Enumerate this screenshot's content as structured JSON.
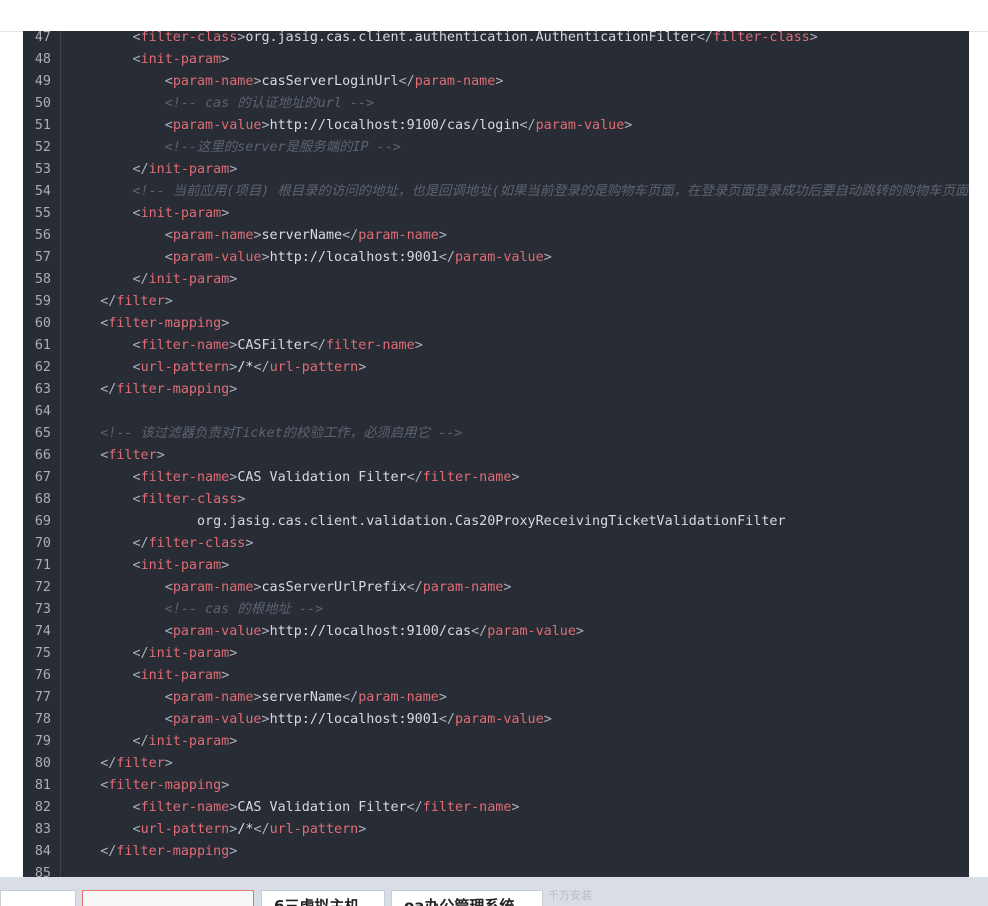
{
  "editor": {
    "lines": [
      {
        "n": "47",
        "t": [
          [
            "",
            "        "
          ],
          [
            "br",
            "<"
          ],
          [
            "tg",
            "filter-class"
          ],
          [
            "br",
            ">"
          ],
          [
            "tx",
            "org.jasig.cas.client.authentication.AuthenticationFilter"
          ],
          [
            "br",
            "</"
          ],
          [
            "tg",
            "filter-class"
          ],
          [
            "br",
            ">"
          ]
        ]
      },
      {
        "n": "48",
        "t": [
          [
            "",
            "        "
          ],
          [
            "br",
            "<"
          ],
          [
            "tg",
            "init-param"
          ],
          [
            "br",
            ">"
          ]
        ]
      },
      {
        "n": "49",
        "t": [
          [
            "",
            "            "
          ],
          [
            "br",
            "<"
          ],
          [
            "tg",
            "param-name"
          ],
          [
            "br",
            ">"
          ],
          [
            "tx",
            "casServerLoginUrl"
          ],
          [
            "br",
            "</"
          ],
          [
            "tg",
            "param-name"
          ],
          [
            "br",
            ">"
          ]
        ]
      },
      {
        "n": "50",
        "t": [
          [
            "",
            "            "
          ],
          [
            "cm",
            "<!-- cas 的认证地址的url -->"
          ]
        ]
      },
      {
        "n": "51",
        "t": [
          [
            "",
            "            "
          ],
          [
            "br",
            "<"
          ],
          [
            "tg",
            "param-value"
          ],
          [
            "br",
            ">"
          ],
          [
            "tx",
            "http://localhost:9100/cas/login"
          ],
          [
            "br",
            "</"
          ],
          [
            "tg",
            "param-value"
          ],
          [
            "br",
            ">"
          ]
        ]
      },
      {
        "n": "52",
        "t": [
          [
            "",
            "            "
          ],
          [
            "cm",
            "<!--这里的server是服务端的IP -->"
          ]
        ]
      },
      {
        "n": "53",
        "t": [
          [
            "",
            "        "
          ],
          [
            "br",
            "</"
          ],
          [
            "tg",
            "init-param"
          ],
          [
            "br",
            ">"
          ]
        ]
      },
      {
        "n": "54",
        "t": [
          [
            "",
            "        "
          ],
          [
            "cm",
            "<!-- 当前应用(项目) 根目录的访问的地址，也是回调地址(如果当前登录的是购物车页面，在登录页面登录成功后要自动跳转的购物车页面"
          ]
        ]
      },
      {
        "n": "55",
        "t": [
          [
            "",
            "        "
          ],
          [
            "br",
            "<"
          ],
          [
            "tg",
            "init-param"
          ],
          [
            "br",
            ">"
          ]
        ]
      },
      {
        "n": "56",
        "t": [
          [
            "",
            "            "
          ],
          [
            "br",
            "<"
          ],
          [
            "tg",
            "param-name"
          ],
          [
            "br",
            ">"
          ],
          [
            "tx",
            "serverName"
          ],
          [
            "br",
            "</"
          ],
          [
            "tg",
            "param-name"
          ],
          [
            "br",
            ">"
          ]
        ]
      },
      {
        "n": "57",
        "t": [
          [
            "",
            "            "
          ],
          [
            "br",
            "<"
          ],
          [
            "tg",
            "param-value"
          ],
          [
            "br",
            ">"
          ],
          [
            "tx",
            "http://localhost:9001"
          ],
          [
            "br",
            "</"
          ],
          [
            "tg",
            "param-value"
          ],
          [
            "br",
            ">"
          ]
        ]
      },
      {
        "n": "58",
        "t": [
          [
            "",
            "        "
          ],
          [
            "br",
            "</"
          ],
          [
            "tg",
            "init-param"
          ],
          [
            "br",
            ">"
          ]
        ]
      },
      {
        "n": "59",
        "t": [
          [
            "",
            "    "
          ],
          [
            "br",
            "</"
          ],
          [
            "tg",
            "filter"
          ],
          [
            "br",
            ">"
          ]
        ]
      },
      {
        "n": "60",
        "t": [
          [
            "",
            "    "
          ],
          [
            "br",
            "<"
          ],
          [
            "tg",
            "filter-mapping"
          ],
          [
            "br",
            ">"
          ]
        ]
      },
      {
        "n": "61",
        "t": [
          [
            "",
            "        "
          ],
          [
            "br",
            "<"
          ],
          [
            "tg",
            "filter-name"
          ],
          [
            "br",
            ">"
          ],
          [
            "tx",
            "CASFilter"
          ],
          [
            "br",
            "</"
          ],
          [
            "tg",
            "filter-name"
          ],
          [
            "br",
            ">"
          ]
        ]
      },
      {
        "n": "62",
        "t": [
          [
            "",
            "        "
          ],
          [
            "br",
            "<"
          ],
          [
            "tg",
            "url-pattern"
          ],
          [
            "br",
            ">"
          ],
          [
            "tx",
            "/*"
          ],
          [
            "br",
            "</"
          ],
          [
            "tg",
            "url-pattern"
          ],
          [
            "br",
            ">"
          ]
        ]
      },
      {
        "n": "63",
        "t": [
          [
            "",
            "    "
          ],
          [
            "br",
            "</"
          ],
          [
            "tg",
            "filter-mapping"
          ],
          [
            "br",
            ">"
          ]
        ]
      },
      {
        "n": "64",
        "t": []
      },
      {
        "n": "65",
        "t": [
          [
            "",
            "    "
          ],
          [
            "cm",
            "<!-- 该过滤器负责对Ticket的校验工作，必须启用它 -->"
          ]
        ]
      },
      {
        "n": "66",
        "t": [
          [
            "",
            "    "
          ],
          [
            "br",
            "<"
          ],
          [
            "tg",
            "filter"
          ],
          [
            "br",
            ">"
          ]
        ]
      },
      {
        "n": "67",
        "t": [
          [
            "",
            "        "
          ],
          [
            "br",
            "<"
          ],
          [
            "tg",
            "filter-name"
          ],
          [
            "br",
            ">"
          ],
          [
            "tx",
            "CAS Validation Filter"
          ],
          [
            "br",
            "</"
          ],
          [
            "tg",
            "filter-name"
          ],
          [
            "br",
            ">"
          ]
        ]
      },
      {
        "n": "68",
        "t": [
          [
            "",
            "        "
          ],
          [
            "br",
            "<"
          ],
          [
            "tg",
            "filter-class"
          ],
          [
            "br",
            ">"
          ]
        ]
      },
      {
        "n": "69",
        "t": [
          [
            "",
            "                "
          ],
          [
            "tx",
            "org.jasig.cas.client.validation.Cas20ProxyReceivingTicketValidationFilter"
          ]
        ]
      },
      {
        "n": "70",
        "t": [
          [
            "",
            "        "
          ],
          [
            "br",
            "</"
          ],
          [
            "tg",
            "filter-class"
          ],
          [
            "br",
            ">"
          ]
        ]
      },
      {
        "n": "71",
        "t": [
          [
            "",
            "        "
          ],
          [
            "br",
            "<"
          ],
          [
            "tg",
            "init-param"
          ],
          [
            "br",
            ">"
          ]
        ]
      },
      {
        "n": "72",
        "t": [
          [
            "",
            "            "
          ],
          [
            "br",
            "<"
          ],
          [
            "tg",
            "param-name"
          ],
          [
            "br",
            ">"
          ],
          [
            "tx",
            "casServerUrlPrefix"
          ],
          [
            "br",
            "</"
          ],
          [
            "tg",
            "param-name"
          ],
          [
            "br",
            ">"
          ]
        ]
      },
      {
        "n": "73",
        "t": [
          [
            "",
            "            "
          ],
          [
            "cm",
            "<!-- cas 的根地址 -->"
          ]
        ]
      },
      {
        "n": "74",
        "t": [
          [
            "",
            "            "
          ],
          [
            "br",
            "<"
          ],
          [
            "tg",
            "param-value"
          ],
          [
            "br",
            ">"
          ],
          [
            "tx",
            "http://localhost:9100/cas"
          ],
          [
            "br",
            "</"
          ],
          [
            "tg",
            "param-value"
          ],
          [
            "br",
            ">"
          ]
        ]
      },
      {
        "n": "75",
        "t": [
          [
            "",
            "        "
          ],
          [
            "br",
            "</"
          ],
          [
            "tg",
            "init-param"
          ],
          [
            "br",
            ">"
          ]
        ]
      },
      {
        "n": "76",
        "t": [
          [
            "",
            "        "
          ],
          [
            "br",
            "<"
          ],
          [
            "tg",
            "init-param"
          ],
          [
            "br",
            ">"
          ]
        ]
      },
      {
        "n": "77",
        "t": [
          [
            "",
            "            "
          ],
          [
            "br",
            "<"
          ],
          [
            "tg",
            "param-name"
          ],
          [
            "br",
            ">"
          ],
          [
            "tx",
            "serverName"
          ],
          [
            "br",
            "</"
          ],
          [
            "tg",
            "param-name"
          ],
          [
            "br",
            ">"
          ]
        ]
      },
      {
        "n": "78",
        "t": [
          [
            "",
            "            "
          ],
          [
            "br",
            "<"
          ],
          [
            "tg",
            "param-value"
          ],
          [
            "br",
            ">"
          ],
          [
            "tx",
            "http://localhost:9001"
          ],
          [
            "br",
            "</"
          ],
          [
            "tg",
            "param-value"
          ],
          [
            "br",
            ">"
          ]
        ]
      },
      {
        "n": "79",
        "t": [
          [
            "",
            "        "
          ],
          [
            "br",
            "</"
          ],
          [
            "tg",
            "init-param"
          ],
          [
            "br",
            ">"
          ]
        ]
      },
      {
        "n": "80",
        "t": [
          [
            "",
            "    "
          ],
          [
            "br",
            "</"
          ],
          [
            "tg",
            "filter"
          ],
          [
            "br",
            ">"
          ]
        ]
      },
      {
        "n": "81",
        "t": [
          [
            "",
            "    "
          ],
          [
            "br",
            "<"
          ],
          [
            "tg",
            "filter-mapping"
          ],
          [
            "br",
            ">"
          ]
        ]
      },
      {
        "n": "82",
        "t": [
          [
            "",
            "        "
          ],
          [
            "br",
            "<"
          ],
          [
            "tg",
            "filter-name"
          ],
          [
            "br",
            ">"
          ],
          [
            "tx",
            "CAS Validation Filter"
          ],
          [
            "br",
            "</"
          ],
          [
            "tg",
            "filter-name"
          ],
          [
            "br",
            ">"
          ]
        ]
      },
      {
        "n": "83",
        "t": [
          [
            "",
            "        "
          ],
          [
            "br",
            "<"
          ],
          [
            "tg",
            "url-pattern"
          ],
          [
            "br",
            ">"
          ],
          [
            "tx",
            "/*"
          ],
          [
            "br",
            "</"
          ],
          [
            "tg",
            "url-pattern"
          ],
          [
            "br",
            ">"
          ]
        ]
      },
      {
        "n": "84",
        "t": [
          [
            "",
            "    "
          ],
          [
            "br",
            "</"
          ],
          [
            "tg",
            "filter-mapping"
          ],
          [
            "br",
            ">"
          ]
        ]
      },
      {
        "n": "85",
        "t": []
      }
    ]
  },
  "taskbar": {
    "items": [
      "",
      "",
      "6三虚拟主机",
      "oa办公管理系统"
    ],
    "ghost": "千万安装"
  },
  "colors": {
    "editor_bg": "#282c34",
    "tag": "#e06c75",
    "text": "#d7dae0",
    "comment": "#5c6370"
  }
}
